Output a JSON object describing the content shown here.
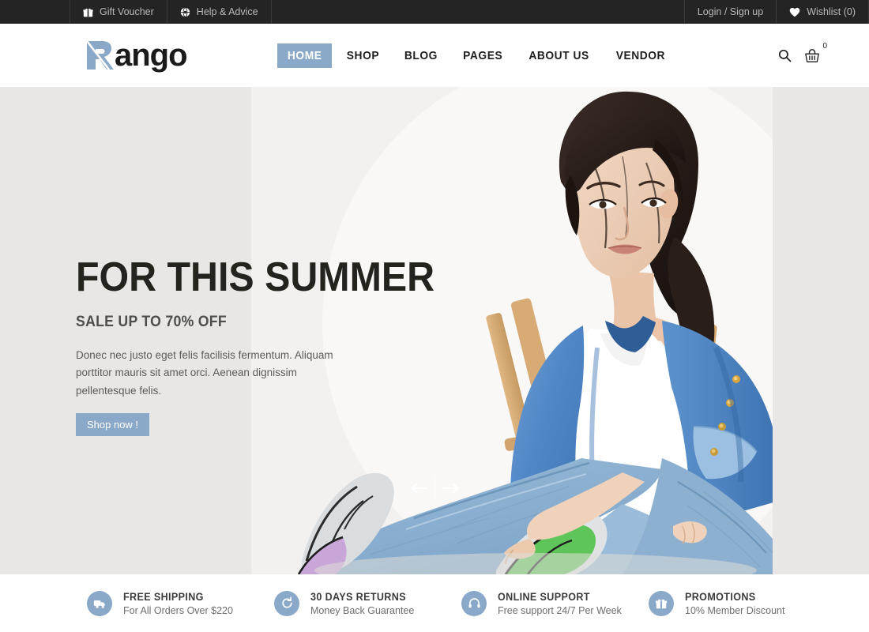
{
  "topbar": {
    "left_items": [
      {
        "icon": "gift-icon",
        "label": "Gift Voucher"
      },
      {
        "icon": "help-globe-icon",
        "label": "Help & Advice"
      }
    ],
    "right_items": [
      {
        "icon": "",
        "label": "Login / Sign up"
      },
      {
        "icon": "heart-icon",
        "label": "Wishlist (0)"
      }
    ]
  },
  "header": {
    "logo_text": "ango",
    "logo_mark_letter": "R",
    "nav": [
      {
        "label": "HOME",
        "active": true
      },
      {
        "label": "SHOP",
        "active": false
      },
      {
        "label": "BLOG",
        "active": false
      },
      {
        "label": "PAGES",
        "active": false
      },
      {
        "label": "ABOUT US",
        "active": false
      },
      {
        "label": "VENDOR",
        "active": false
      }
    ],
    "search_icon": "search-icon",
    "cart_icon": "basket-icon",
    "cart_count": "0"
  },
  "hero": {
    "title": "FOR THIS SUMMER",
    "subtitle": "SALE UP TO 70% OFF",
    "description": "Donec nec justo eget felis facilisis fermentum. Aliquam porttitor mauris sit amet orci. Aenean dignissim pellentesque felis.",
    "cta_label": "Shop now !",
    "prev_label": "←",
    "next_label": "→",
    "background_color": "#e8e7e5",
    "accent_color": "#8aa9c8"
  },
  "features": [
    {
      "icon": "truck-icon",
      "title": "FREE SHIPPING",
      "subtitle": "For All Orders Over $220"
    },
    {
      "icon": "return-icon",
      "title": "30 DAYS RETURNS",
      "subtitle": "Money Back Guarantee"
    },
    {
      "icon": "headset-icon",
      "title": "ONLINE SUPPORT",
      "subtitle": "Free support 24/7 Per Week"
    },
    {
      "icon": "gift-icon",
      "title": "PROMOTIONS",
      "subtitle": "10% Member Discount"
    }
  ]
}
